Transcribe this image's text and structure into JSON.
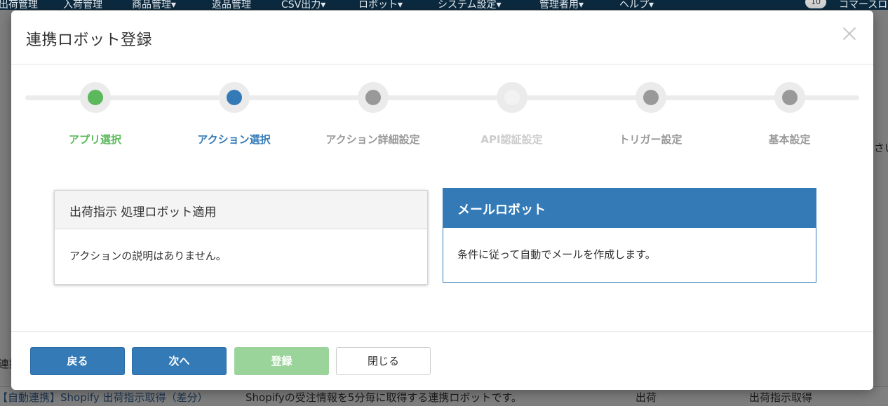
{
  "background": {
    "nav_items": [
      "出荷管理",
      "入荷管理",
      "商品管理▾",
      "返品管理",
      "CSV出力▾",
      "ロボット▾",
      "システム設定▾",
      "管理者用▾",
      "ヘルプ▾"
    ],
    "notification_count": "10",
    "user_label": "コマースロ",
    "side_text": "さい",
    "row_label_left": "連携",
    "table_row": {
      "name": "【自動連携】Shopify 出荷指示取得（差分）",
      "description": "Shopifyの受注情報を5分毎に取得する連携ロボットです。",
      "category": "出荷",
      "action": "出荷指示取得"
    }
  },
  "modal": {
    "title": "連携ロボット登録",
    "steps": [
      {
        "label": "アプリ選択",
        "state": "done",
        "color": "#5cb85c"
      },
      {
        "label": "アクション選択",
        "state": "active",
        "color": "#337ab7"
      },
      {
        "label": "アクション詳細設定",
        "state": "pending",
        "color": "#999999"
      },
      {
        "label": "API認証設定",
        "state": "disabled",
        "color": "#cccccc"
      },
      {
        "label": "トリガー設定",
        "state": "pending",
        "color": "#999999"
      },
      {
        "label": "基本設定",
        "state": "pending",
        "color": "#999999"
      }
    ],
    "actions": [
      {
        "title": "出荷指示 処理ロボット適用",
        "description": "アクションの説明はありません。",
        "selected": false
      },
      {
        "title": "メールロボット",
        "description": "条件に従って自動でメールを作成します。",
        "selected": true
      }
    ],
    "buttons": {
      "back": "戻る",
      "next": "次へ",
      "register": "登録",
      "close": "閉じる"
    }
  }
}
